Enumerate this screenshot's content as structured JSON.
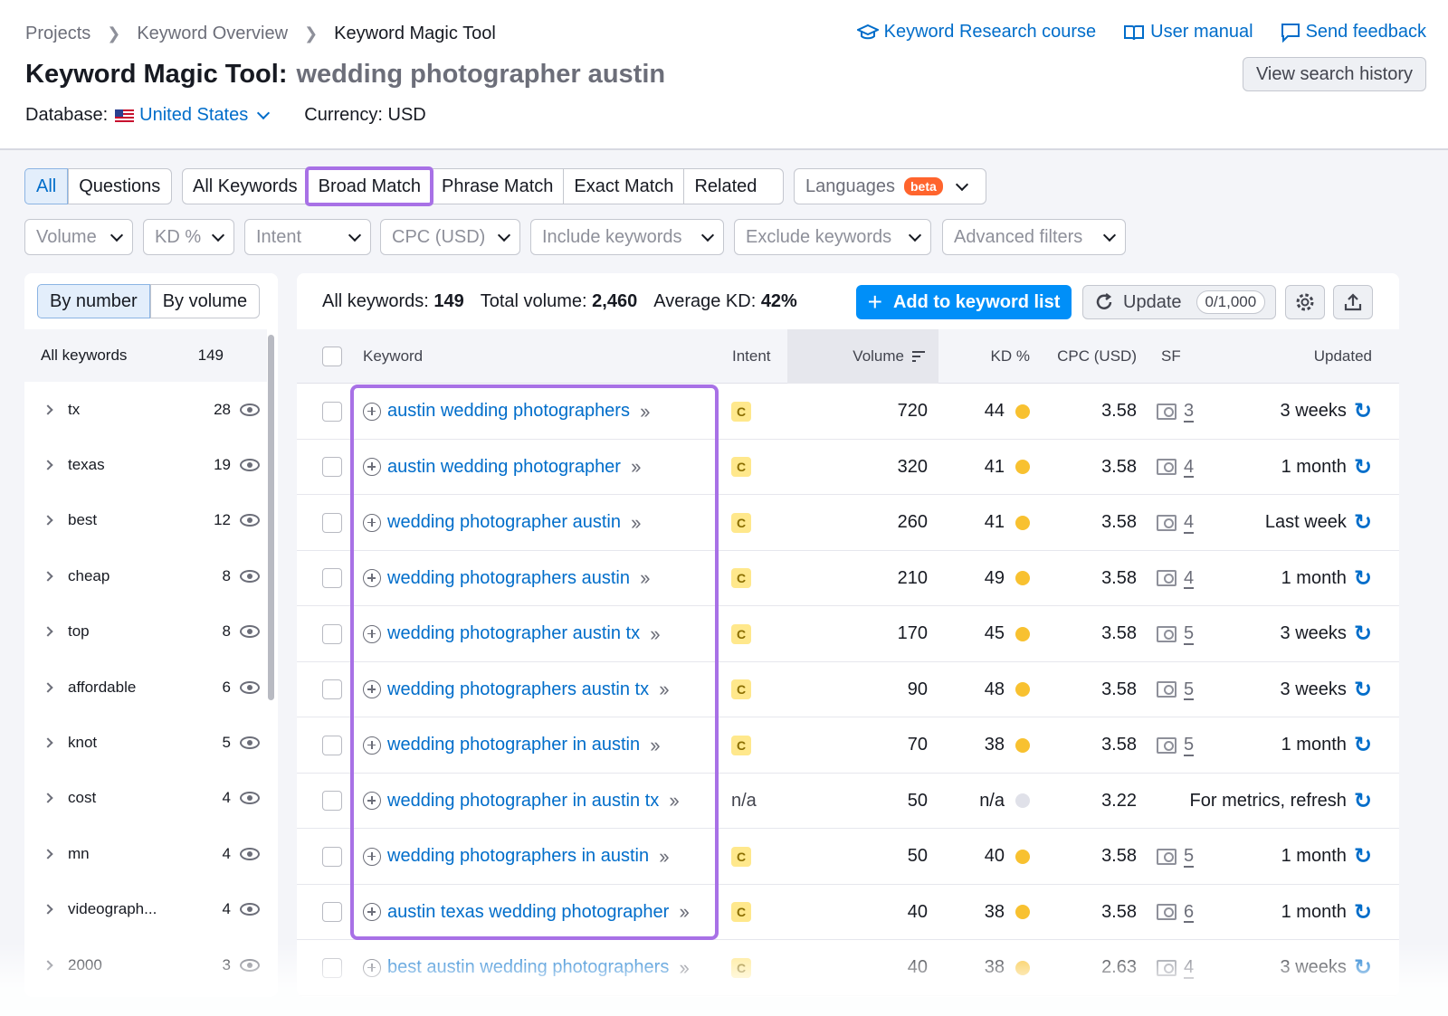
{
  "breadcrumbs": [
    "Projects",
    "Keyword Overview",
    "Keyword Magic Tool"
  ],
  "top_links": [
    "Keyword Research course",
    "User manual",
    "Send feedback"
  ],
  "title": "Keyword Magic Tool:",
  "query": "wedding photographer austin",
  "history_button": "View search history",
  "database_label": "Database:",
  "database_value": "United States",
  "currency": "Currency: USD",
  "seg_type": [
    "All",
    "Questions"
  ],
  "seg_match": [
    "All Keywords",
    "Broad Match",
    "Phrase Match",
    "Exact Match",
    "Related"
  ],
  "languages": {
    "label": "Languages",
    "badge": "beta"
  },
  "filters": [
    "Volume",
    "KD %",
    "Intent",
    "CPC (USD)",
    "Include keywords",
    "Exclude keywords",
    "Advanced filters"
  ],
  "left": {
    "toggle": [
      "By number",
      "By volume"
    ],
    "all_label": "All keywords",
    "all_count": "149",
    "groups": [
      {
        "name": "tx",
        "count": "28"
      },
      {
        "name": "texas",
        "count": "19"
      },
      {
        "name": "best",
        "count": "12"
      },
      {
        "name": "cheap",
        "count": "8"
      },
      {
        "name": "top",
        "count": "8"
      },
      {
        "name": "affordable",
        "count": "6"
      },
      {
        "name": "knot",
        "count": "5"
      },
      {
        "name": "cost",
        "count": "4"
      },
      {
        "name": "mn",
        "count": "4"
      },
      {
        "name": "videograph...",
        "count": "4"
      },
      {
        "name": "2000",
        "count": "3"
      }
    ]
  },
  "stats": {
    "all_label": "All keywords:",
    "all_value": "149",
    "vol_label": "Total volume:",
    "vol_value": "2,460",
    "kd_label": "Average KD:",
    "kd_value": "42%"
  },
  "add_button": "Add to keyword list",
  "update_button": "Update",
  "update_quota": "0/1,000",
  "columns": [
    "Keyword",
    "Intent",
    "Volume",
    "KD %",
    "CPC (USD)",
    "SF",
    "Updated"
  ],
  "colors": {
    "accent": "#006dca",
    "highlight": "#a871e6",
    "kd_yellow": "#f8c130",
    "kd_na": "#e0e1e9"
  },
  "rows": [
    {
      "keyword": "austin wedding photographers",
      "intent": "C",
      "volume": "720",
      "kd": "44",
      "kd_color": "#f8c130",
      "cpc": "3.58",
      "sf": "3",
      "updated": "3 weeks"
    },
    {
      "keyword": "austin wedding photographer",
      "intent": "C",
      "volume": "320",
      "kd": "41",
      "kd_color": "#f8c130",
      "cpc": "3.58",
      "sf": "4",
      "updated": "1 month"
    },
    {
      "keyword": "wedding photographer austin",
      "intent": "C",
      "volume": "260",
      "kd": "41",
      "kd_color": "#f8c130",
      "cpc": "3.58",
      "sf": "4",
      "updated": "Last week"
    },
    {
      "keyword": "wedding photographers austin",
      "intent": "C",
      "volume": "210",
      "kd": "49",
      "kd_color": "#f8c130",
      "cpc": "3.58",
      "sf": "4",
      "updated": "1 month"
    },
    {
      "keyword": "wedding photographer austin tx",
      "intent": "C",
      "volume": "170",
      "kd": "45",
      "kd_color": "#f8c130",
      "cpc": "3.58",
      "sf": "5",
      "updated": "3 weeks"
    },
    {
      "keyword": "wedding photographers austin tx",
      "intent": "C",
      "volume": "90",
      "kd": "48",
      "kd_color": "#f8c130",
      "cpc": "3.58",
      "sf": "5",
      "updated": "3 weeks"
    },
    {
      "keyword": "wedding photographer in austin",
      "intent": "C",
      "volume": "70",
      "kd": "38",
      "kd_color": "#f8c130",
      "cpc": "3.58",
      "sf": "5",
      "updated": "1 month"
    },
    {
      "keyword": "wedding photographer in austin tx",
      "intent": "n/a",
      "volume": "50",
      "kd": "n/a",
      "kd_color": "#e0e1e9",
      "cpc": "3.22",
      "sf": "",
      "updated": "For metrics, refresh"
    },
    {
      "keyword": "wedding photographers in austin",
      "intent": "C",
      "volume": "50",
      "kd": "40",
      "kd_color": "#f8c130",
      "cpc": "3.58",
      "sf": "5",
      "updated": "1 month"
    },
    {
      "keyword": "austin texas wedding photographer",
      "intent": "C",
      "volume": "40",
      "kd": "38",
      "kd_color": "#f8c130",
      "cpc": "3.58",
      "sf": "6",
      "updated": "1 month"
    },
    {
      "keyword": "best austin wedding photographers",
      "intent": "C",
      "volume": "40",
      "kd": "38",
      "kd_color": "#f8c130",
      "cpc": "2.63",
      "sf": "4",
      "updated": "3 weeks"
    }
  ]
}
